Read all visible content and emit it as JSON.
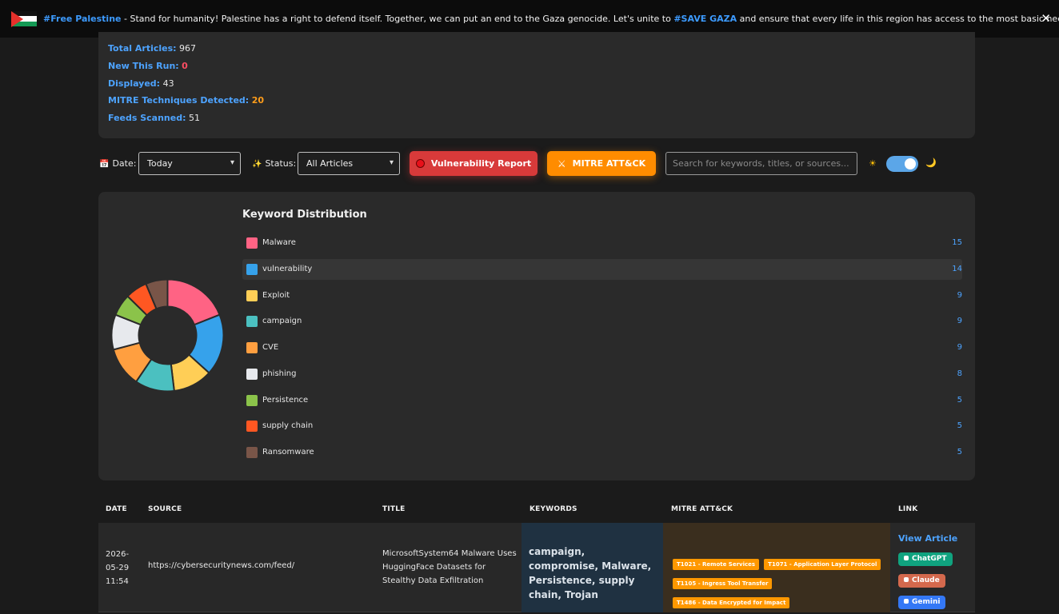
{
  "banner": {
    "hashtag": "#Free Palestine",
    "message_1": " - Stand for humanity! Palestine has a right to defend itself. Together, we can put an end to the Gaza genocide. Let's unite to ",
    "hashtag_2": "#SAVE GAZA",
    "message_2": " and ensure that every life in this region has access to the most basic necessities.",
    "close": "✕"
  },
  "stats": {
    "total_label": "Total Articles:",
    "total_value": "967",
    "new_label": "New This Run:",
    "new_value": "0",
    "displayed_label": "Displayed:",
    "displayed_value": "43",
    "mitre_label": "MITRE Techniques Detected:",
    "mitre_value": "20",
    "feeds_label": "Feeds Scanned:",
    "feeds_value": "51"
  },
  "filters": {
    "date_icon": "📅",
    "date_label": "Date:",
    "date_value": "Today",
    "status_icon": "✨",
    "status_label": "Status:",
    "status_value": "All Articles",
    "vuln_button": "Vulnerability Report",
    "mitre_icon": "⚔",
    "mitre_button": "MITRE ATT&CK",
    "search_placeholder": "Search for keywords, titles, or sources...",
    "sun_icon": "☀",
    "moon_icon": "🌙"
  },
  "chart_data": {
    "type": "pie",
    "title": "Keyword Distribution",
    "categories": [
      "Malware",
      "vulnerability",
      "Exploit",
      "campaign",
      "CVE",
      "phishing",
      "Persistence",
      "supply chain",
      "Ransomware"
    ],
    "values": [
      15,
      14,
      9,
      9,
      9,
      8,
      5,
      5,
      5
    ],
    "colors": [
      "#ff6384",
      "#36a2eb",
      "#ffce56",
      "#4bc0c0",
      "#ff9f40",
      "#e7e9ed",
      "#8bc34a",
      "#ff5722",
      "#795548"
    ],
    "highlighted": "vulnerability",
    "legend_placement": "right"
  },
  "table": {
    "headers": [
      "DATE",
      "SOURCE",
      "TITLE",
      "KEYWORDS",
      "MITRE ATT&CK",
      "LINK"
    ],
    "rows": [
      {
        "date_1": "2026-",
        "date_2": "05-29",
        "date_3": "11:54",
        "source": "https://cybersecuritynews.com/feed/",
        "title": "MicrosoftSystem64 Malware Uses HuggingFace Datasets for Stealthy Data Exfiltration",
        "keywords": "campaign, compromise, Malware, Persistence, supply chain, Trojan",
        "mitre": [
          "T1021 - Remote Services",
          "T1071 - Application Layer Protocol",
          "T1105 - Ingress Tool Transfer",
          "T1486 - Data Encrypted for Impact"
        ],
        "view_link": "View Article",
        "chatgpt": "ChatGPT",
        "claude": "Claude",
        "gemini": "Gemini",
        "chatgpt_color": "#10a37f",
        "claude_color": "#d4694d",
        "gemini_color": "#3478f6"
      }
    ]
  }
}
